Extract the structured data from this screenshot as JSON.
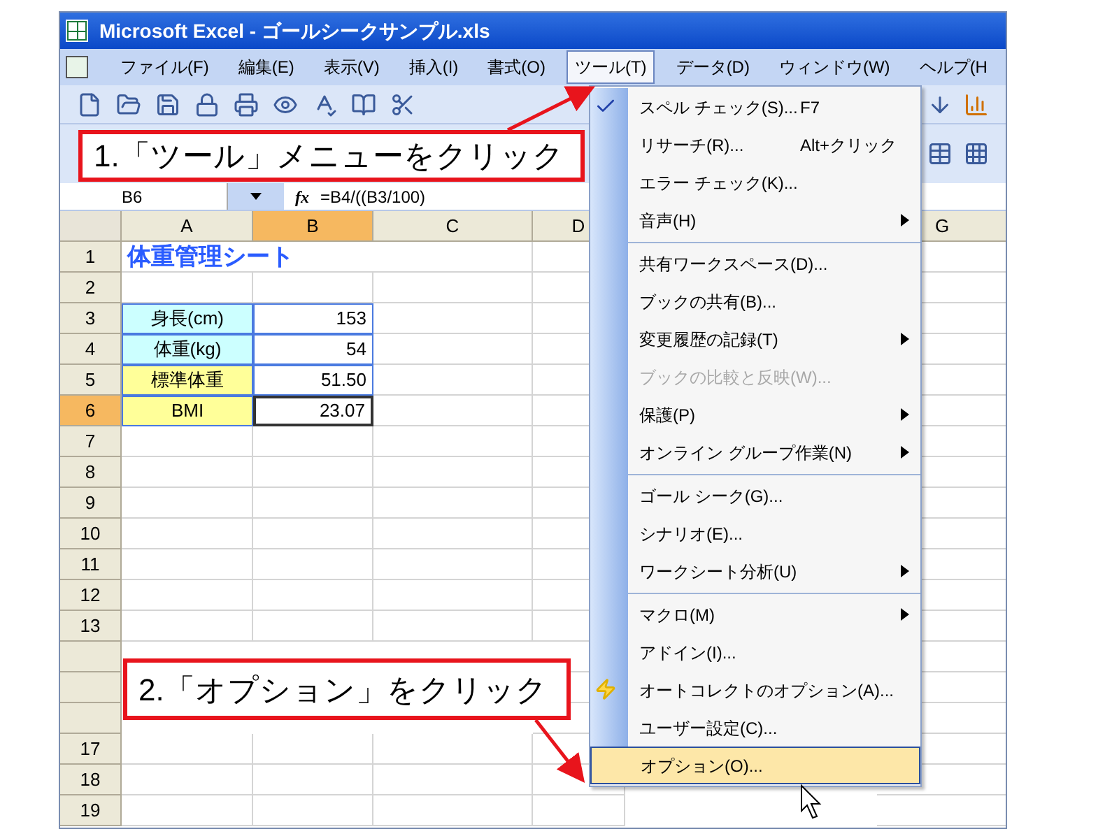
{
  "window": {
    "title": "Microsoft Excel - ゴールシークサンプル.xls"
  },
  "menu_bar": [
    {
      "label": "ファイル(F)",
      "selected": false
    },
    {
      "label": "編集(E)",
      "selected": false
    },
    {
      "label": "表示(V)",
      "selected": false
    },
    {
      "label": "挿入(I)",
      "selected": false
    },
    {
      "label": "書式(O)",
      "selected": false
    },
    {
      "label": "ツール(T)",
      "selected": true
    },
    {
      "label": "データ(D)",
      "selected": false
    },
    {
      "label": "ウィンドウ(W)",
      "selected": false
    },
    {
      "label": "ヘルプ(H",
      "selected": false
    }
  ],
  "formula_bar": {
    "name_box": "B6",
    "fx_label": "fx",
    "formula": "=B4/((B3/100)"
  },
  "sheet": {
    "columns": [
      {
        "label": "A",
        "selected": false
      },
      {
        "label": "B",
        "selected": true
      },
      {
        "label": "C",
        "selected": false
      },
      {
        "label": "D",
        "selected": false
      },
      {
        "label": "G",
        "selected": false
      }
    ],
    "rows": [
      {
        "label": "1",
        "selected": false,
        "cells": [
          {
            "text": "体重管理シート",
            "kind": "title",
            "selected": false
          }
        ]
      },
      {
        "label": "2",
        "selected": false
      },
      {
        "label": "3",
        "selected": false,
        "cells": [
          {
            "text": "身長(cm)",
            "kind": "label",
            "color": "#ccffff",
            "selected": false
          },
          {
            "text": "153",
            "kind": "number",
            "selected": false
          }
        ]
      },
      {
        "label": "4",
        "selected": false,
        "cells": [
          {
            "text": "体重(kg)",
            "kind": "label",
            "color": "#ccffff",
            "selected": false
          },
          {
            "text": "54",
            "kind": "number",
            "selected": false
          }
        ]
      },
      {
        "label": "5",
        "selected": false,
        "cells": [
          {
            "text": "標準体重",
            "kind": "label",
            "color": "#ffff99",
            "selected": false
          },
          {
            "text": "51.50",
            "kind": "number",
            "selected": false
          }
        ]
      },
      {
        "label": "6",
        "selected": true,
        "cells": [
          {
            "text": "BMI",
            "kind": "label",
            "color": "#ffff99",
            "selected": false
          },
          {
            "text": "23.07",
            "kind": "number",
            "selected": true
          }
        ]
      },
      {
        "label": "7",
        "selected": false
      },
      {
        "label": "8",
        "selected": false
      },
      {
        "label": "9",
        "selected": false
      },
      {
        "label": "10",
        "selected": false
      },
      {
        "label": "11",
        "selected": false
      },
      {
        "label": "12",
        "selected": false
      },
      {
        "label": "13",
        "selected": false
      },
      {
        "selected": false
      },
      {
        "selected": false
      },
      {
        "selected": false
      },
      {
        "label": "17",
        "selected": false
      },
      {
        "label": "18",
        "selected": false
      },
      {
        "label": "19",
        "selected": false
      }
    ]
  },
  "dropdown_menu": {
    "items": [
      {
        "kind": "icon_item",
        "label": "スペル チェック(S)...",
        "shortcut": "F7",
        "submenu": false,
        "disabled": false,
        "selected": false
      },
      {
        "kind": "item",
        "label": "リサーチ(R)...",
        "shortcut": "Alt+クリック",
        "submenu": false,
        "disabled": false,
        "selected": false
      },
      {
        "kind": "item",
        "label": "エラー チェック(K)...",
        "submenu": false,
        "disabled": false,
        "selected": false
      },
      {
        "kind": "item",
        "label": "音声(H)",
        "submenu": true,
        "disabled": false,
        "selected": false
      },
      {
        "kind": "separator"
      },
      {
        "kind": "item",
        "label": "共有ワークスペース(D)...",
        "submenu": false,
        "disabled": false,
        "selected": false
      },
      {
        "kind": "item",
        "label": "ブックの共有(B)...",
        "submenu": false,
        "disabled": false,
        "selected": false
      },
      {
        "kind": "item",
        "label": "変更履歴の記録(T)",
        "submenu": true,
        "disabled": false,
        "selected": false
      },
      {
        "kind": "item",
        "label": "ブックの比較と反映(W)...",
        "submenu": false,
        "disabled": true,
        "selected": false
      },
      {
        "kind": "item",
        "label": "保護(P)",
        "submenu": true,
        "disabled": false,
        "selected": false
      },
      {
        "kind": "item",
        "label": "オンライン グループ作業(N)",
        "submenu": true,
        "disabled": false,
        "selected": false
      },
      {
        "kind": "separator"
      },
      {
        "kind": "item",
        "label": "ゴール シーク(G)...",
        "submenu": false,
        "disabled": false,
        "selected": false
      },
      {
        "kind": "item",
        "label": "シナリオ(E)...",
        "submenu": false,
        "disabled": false,
        "selected": false
      },
      {
        "kind": "item",
        "label": "ワークシート分析(U)",
        "submenu": true,
        "disabled": false,
        "selected": false
      },
      {
        "kind": "separator"
      },
      {
        "kind": "item",
        "label": "マクロ(M)",
        "submenu": true,
        "disabled": false,
        "selected": false
      },
      {
        "kind": "item",
        "label": "アドイン(I)...",
        "submenu": false,
        "disabled": false,
        "selected": false
      },
      {
        "kind": "icon_item",
        "label": "オートコレクトのオプション(A)...",
        "submenu": false,
        "disabled": false,
        "selected": false
      },
      {
        "kind": "item",
        "label": "ユーザー設定(C)...",
        "submenu": false,
        "disabled": false,
        "selected": false
      },
      {
        "kind": "item",
        "label": "オプション(O)...",
        "submenu": false,
        "disabled": false,
        "selected": true
      }
    ]
  },
  "callouts": [
    {
      "text": "1.「ツール」メニューをクリック"
    },
    {
      "text": "2.「オプション」をクリック"
    }
  ]
}
